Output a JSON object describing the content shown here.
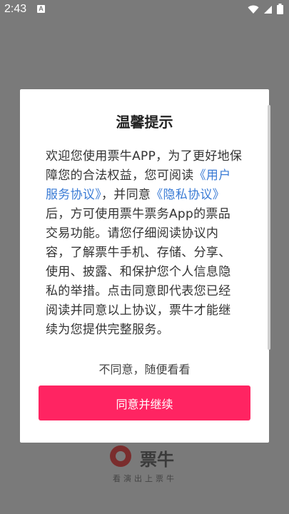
{
  "status_bar": {
    "time": "2:43",
    "notification_badge": "A",
    "icons": [
      "wifi-icon",
      "signal-icon",
      "battery-icon"
    ]
  },
  "dialog": {
    "title": "温馨提示",
    "body_part1": "欢迎您使用票牛APP，为了更好地保障您的合法权益，您可阅读",
    "link_user_agreement": "《用户服务协议》",
    "body_part2": "，并同意",
    "link_privacy": "《隐私协议》",
    "body_part3": "后，方可使用票牛票务App的票品交易功能。请您仔细阅读协议内容，了解票牛手机、存储、分享、使用、披露、和保护您个人信息隐私的举措。点击同意即代表您已经阅读并同意以上协议，票牛才能继续为您提供完整服务。",
    "disagree_label": "不同意，随便看看",
    "agree_label": "同意并继续"
  },
  "branding": {
    "logo_text": "票牛",
    "slogan": "看演出上票牛"
  },
  "colors": {
    "accent": "#ff2462",
    "link": "#3a7bd5",
    "overlay": "#7a7a7a"
  }
}
